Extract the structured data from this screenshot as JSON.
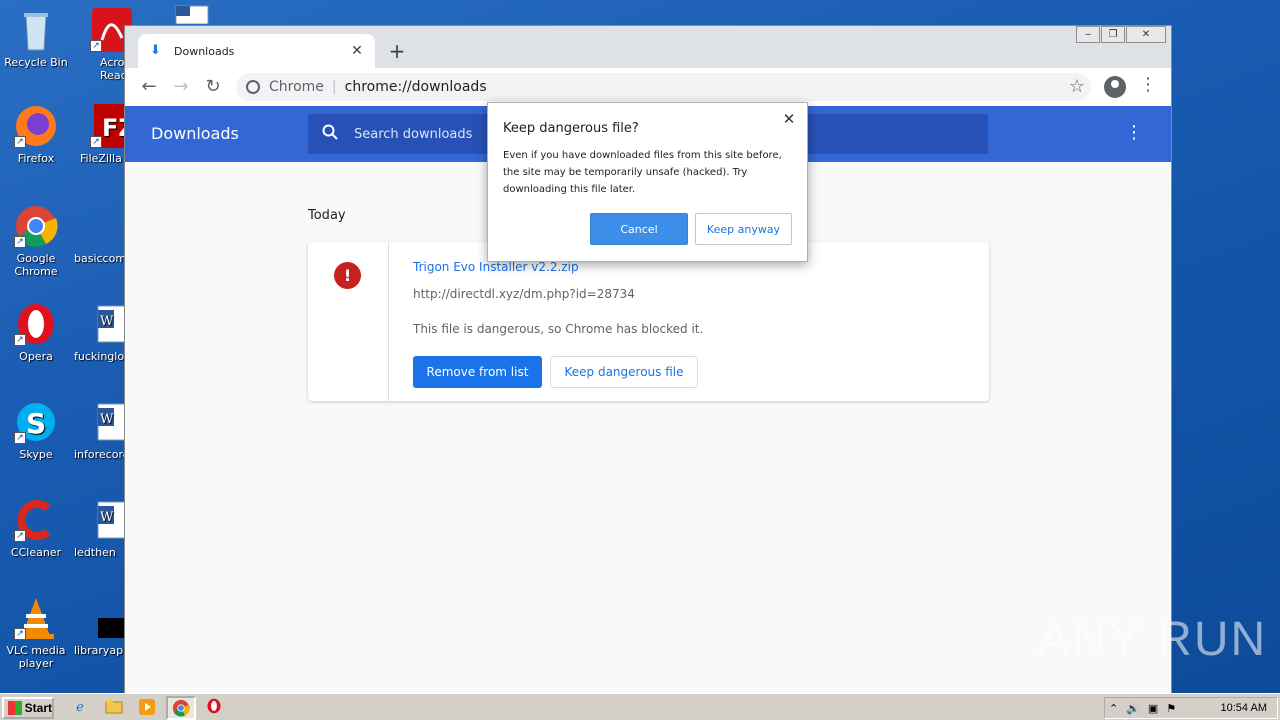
{
  "desktop": {
    "icons": [
      {
        "label": "Recycle Bin"
      },
      {
        "label": "Acrobat Reader"
      },
      {
        "label": "Firefox"
      },
      {
        "label": "FileZilla C"
      },
      {
        "label": "Google Chrome"
      },
      {
        "label": "basiccomm"
      },
      {
        "label": "Opera"
      },
      {
        "label": "fuckingloc"
      },
      {
        "label": "Skype"
      },
      {
        "label": "inforecord"
      },
      {
        "label": "CCleaner"
      },
      {
        "label": "ledthen"
      },
      {
        "label": "VLC media player"
      },
      {
        "label": "libraryapp"
      }
    ]
  },
  "browser": {
    "tab_title": "Downloads",
    "new_tab_symbol": "+",
    "omnibox_scheme_label": "Chrome",
    "omnibox_url": "chrome://downloads"
  },
  "downloads_page": {
    "title": "Downloads",
    "search_placeholder": "Search downloads",
    "section_date": "Today",
    "item": {
      "file_name": "Trigon Evo Installer v2.2.zip",
      "url": "http://directdl.xyz/dm.php?id=28734",
      "status": "This file is dangerous, so Chrome has blocked it.",
      "remove_label": "Remove from list",
      "keep_label": "Keep dangerous file"
    }
  },
  "dialog": {
    "title": "Keep dangerous file?",
    "body": "Even if you have downloaded files from this site before, the site may be temporarily unsafe (hacked). Try downloading this file later.",
    "cancel_label": "Cancel",
    "keep_label": "Keep anyway"
  },
  "taskbar": {
    "start_label": "Start",
    "clock": "10:54 AM"
  },
  "watermark": "ANY RUN",
  "colors": {
    "header_blue": "#3367d6",
    "link_blue": "#1a73e8",
    "danger_red": "#c5221f"
  }
}
